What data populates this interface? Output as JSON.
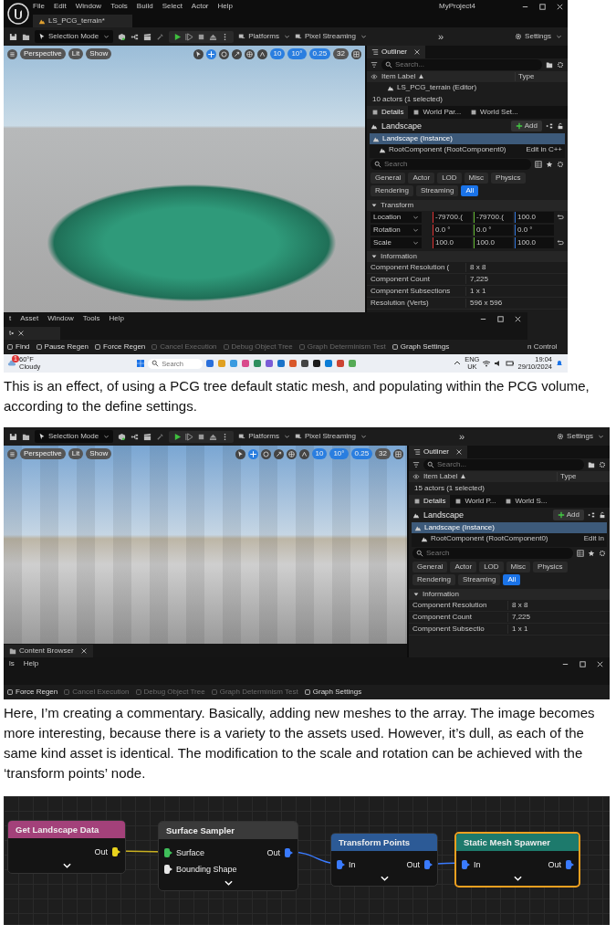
{
  "screenshots": [
    {
      "menu_bar": {
        "items": [
          "File",
          "Edit",
          "Window",
          "Tools",
          "Build",
          "Select",
          "Actor",
          "Help"
        ],
        "project": "MyProject4"
      },
      "document_tab": "LS_PCG_terrain*",
      "toolbar": {
        "mode": "Selection Mode",
        "menus": [
          "Platforms",
          "Pixel Streaming"
        ],
        "overflow": "»",
        "settings": "Settings"
      },
      "viewport": {
        "kind": "terrain",
        "view_buttons": [
          "Perspective",
          "Lit",
          "Show"
        ],
        "snap_values": [
          "10",
          "10°",
          "0.25",
          "32"
        ]
      },
      "outliner": {
        "title": "Outliner",
        "search": {
          "placeholder": "Search..."
        },
        "columns": [
          "Item Label ▲",
          "Type"
        ],
        "rows": [
          "LS_PCG_terrain (Editor)"
        ],
        "count": "10 actors (1 selected)"
      },
      "details": {
        "tabs": [
          {
            "label": "Details",
            "selected": true
          },
          {
            "label": "World Par...",
            "selected": false
          },
          {
            "label": "World Set...",
            "selected": false
          }
        ],
        "actor": "Landscape",
        "add_button": "Add",
        "components": [
          {
            "label": "Landscape (Instance)",
            "selected": true
          },
          {
            "label": "RootComponent (RootComponent0)",
            "selected": false,
            "note": "Edit in C++"
          }
        ],
        "search": {
          "placeholder": "Search"
        },
        "filters": [
          {
            "label": "General",
            "selected": false
          },
          {
            "label": "Actor",
            "selected": false
          },
          {
            "label": "LOD",
            "selected": false
          },
          {
            "label": "Misc",
            "selected": false
          },
          {
            "label": "Physics",
            "selected": false
          },
          {
            "label": "Rendering",
            "selected": false
          },
          {
            "label": "Streaming",
            "selected": false
          },
          {
            "label": "All",
            "selected": true
          }
        ],
        "sections": [
          {
            "title": "Transform",
            "rows": [
              {
                "kind": "vector",
                "label": "Location",
                "values": [
                  "-79700.(",
                  "-79700.(",
                  "100.0"
                ],
                "reset": true
              },
              {
                "kind": "vector",
                "label": "Rotation",
                "values": [
                  "0.0 °",
                  "0.0 °",
                  "0.0 °"
                ],
                "reset": false
              },
              {
                "kind": "vector",
                "label": "Scale",
                "values": [
                  "100.0",
                  "100.0",
                  "100.0"
                ],
                "reset": true
              }
            ]
          },
          {
            "title": "Information",
            "rows": [
              {
                "kind": "info",
                "label": "Component Resolution (",
                "value": "8 x 8"
              },
              {
                "kind": "info",
                "label": "Component Count",
                "value": "7,225"
              },
              {
                "kind": "info",
                "label": "Component Subsections",
                "value": "1 x 1"
              },
              {
                "kind": "info",
                "label": "Resolution (Verts)",
                "value": "596 x 596"
              }
            ]
          }
        ]
      },
      "pcg_window": {
        "menu": [
          "t",
          "Asset",
          "Window",
          "Tools",
          "Help"
        ],
        "tab": "t•",
        "tools": [
          {
            "label": "Find",
            "disabled": false
          },
          {
            "label": "Pause Regen",
            "disabled": false
          },
          {
            "label": "Force Regen",
            "disabled": false
          },
          {
            "label": "Cancel Execution",
            "disabled": true
          },
          {
            "label": "Debug Object Tree",
            "disabled": true
          },
          {
            "label": "Graph Determinism Test",
            "disabled": true
          },
          {
            "label": "Graph Settings",
            "disabled": false
          }
        ]
      },
      "behind_text": "n Control",
      "taskbar": {
        "weather_badge": "1",
        "temperature": "60°F",
        "weather": "Cloudy",
        "search": {
          "placeholder": "Search"
        },
        "language": "ENG",
        "region": "UK",
        "time": "19:04",
        "date": "29/10/2024"
      },
      "caption": "This is an effect, of using a PCG tree default static mesh, and populating within the PCG volume, according to the define settings."
    },
    {
      "toolbar": {
        "mode": "Selection Mode",
        "menus": [
          "Platforms",
          "Pixel Streaming"
        ],
        "overflow": "»",
        "settings": "Settings"
      },
      "viewport": {
        "kind": "graveyard",
        "view_buttons": [
          "Perspective",
          "Lit",
          "Show"
        ],
        "snap_values": [
          "10",
          "10°",
          "0.25",
          "32"
        ]
      },
      "bottom_tab": "Content Browser",
      "outliner": {
        "title": "Outliner",
        "search": {
          "placeholder": "Search..."
        },
        "columns": [
          "Item Label ▲",
          "Type"
        ],
        "count": "15 actors (1 selected)"
      },
      "details": {
        "tabs": [
          {
            "label": "Details",
            "selected": true
          },
          {
            "label": "World P...",
            "selected": false
          },
          {
            "label": "World S...",
            "selected": false
          }
        ],
        "actor": "Landscape",
        "add_button": "Add",
        "components": [
          {
            "label": "Landscape (Instance)",
            "selected": true
          },
          {
            "label": "RootComponent (RootComponent0)",
            "selected": false,
            "note": "Edit in"
          }
        ],
        "search": {
          "placeholder": "Search"
        },
        "filters": [
          {
            "label": "General",
            "selected": false
          },
          {
            "label": "Actor",
            "selected": false
          },
          {
            "label": "LOD",
            "selected": false
          },
          {
            "label": "Misc",
            "selected": false
          },
          {
            "label": "Physics",
            "selected": false
          },
          {
            "label": "Rendering",
            "selected": false
          },
          {
            "label": "Streaming",
            "selected": false
          },
          {
            "label": "All",
            "selected": true
          }
        ],
        "sections": [
          {
            "title": "Information",
            "rows": [
              {
                "kind": "info",
                "label": "Component Resolution",
                "value": "8 x 8"
              },
              {
                "kind": "info",
                "label": "Component Count",
                "value": "7,225"
              },
              {
                "kind": "info",
                "label": "Component Subsectio",
                "value": "1 x 1"
              }
            ]
          }
        ]
      },
      "pcg_window": {
        "menu": [
          "ls",
          "Help"
        ],
        "tools": [
          {
            "label": "Force Regen",
            "disabled": false
          },
          {
            "label": "Cancel Execution",
            "disabled": true
          },
          {
            "label": "Debug Object Tree",
            "disabled": true
          },
          {
            "label": "Graph Determinism Test",
            "disabled": true
          },
          {
            "label": "Graph Settings",
            "disabled": false
          }
        ]
      },
      "caption": "Here, I’m creating a commentary. Basically, adding new meshes to the array. The image becomes more interesting, because there is a variety to the assets used. However, it’s dull, as each of the same kind asset is identical. The modification to the scale and rotation can be achieved with the ‘transform points’ node."
    }
  ],
  "node_graph": {
    "nodes": [
      {
        "title": "Get Landscape Data",
        "color": "#a3417a",
        "selected": false,
        "outputs": [
          {
            "label": "Out",
            "color": "#e8d21d"
          }
        ]
      },
      {
        "title": "Surface Sampler",
        "color": "#3a3a3a",
        "selected": false,
        "inputs": [
          {
            "label": "Surface",
            "color": "#3fbf5a"
          },
          {
            "label": "Bounding Shape",
            "color": "#e6e6e6"
          }
        ],
        "outputs": [
          {
            "label": "Out",
            "color": "#3a7bff"
          }
        ]
      },
      {
        "title": "Transform Points",
        "color": "#2c5a96",
        "selected": false,
        "inputs": [
          {
            "label": "In",
            "color": "#3a7bff"
          }
        ],
        "outputs": [
          {
            "label": "Out",
            "color": "#3a7bff"
          }
        ]
      },
      {
        "title": "Static Mesh Spawner",
        "color": "#1d7a6c",
        "selected": true,
        "inputs": [
          {
            "label": "In",
            "color": "#3a7bff"
          }
        ],
        "outputs": [
          {
            "label": "Out",
            "color": "#3a7bff"
          }
        ]
      }
    ]
  }
}
